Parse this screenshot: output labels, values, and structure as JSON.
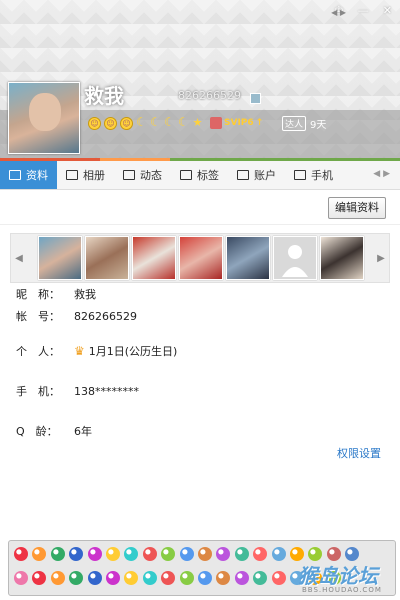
{
  "window": {
    "minimize_icon": "minimize-icon",
    "close_icon": "close-icon",
    "pin_label": "♔",
    "min_label": "—",
    "close_label": "✕"
  },
  "profile": {
    "nickname": "救我",
    "qq_number": "826266529",
    "svip_label": "SVIP6",
    "daren_tag": "达人",
    "daren_days": "9天"
  },
  "tabs": [
    {
      "label": "资料",
      "icon": "profile-card-icon",
      "active": true
    },
    {
      "label": "相册",
      "icon": "photo-icon"
    },
    {
      "label": "动态",
      "icon": "feed-icon"
    },
    {
      "label": "标签",
      "icon": "tag-icon"
    },
    {
      "label": "账户",
      "icon": "wallet-icon"
    },
    {
      "label": "手机",
      "icon": "phone-icon"
    }
  ],
  "edit_button": "编辑资料",
  "fields": {
    "nickname": {
      "label": "昵　称：",
      "value": "救我"
    },
    "account": {
      "label": "帐　号：",
      "value": "826266529"
    },
    "personal": {
      "label": "个　人：",
      "value": "1月1日(公历生日)"
    },
    "phone": {
      "label": "手　机：",
      "value": "138********"
    },
    "qage": {
      "label": "Q　龄：",
      "value": "6年"
    }
  },
  "permission_link": "权限设置",
  "watermark": {
    "big": "猴岛论坛",
    "small": "BBS.HOUDAO.COM"
  },
  "colors": {
    "accent": "#3a8fd6",
    "link": "#2a78c8",
    "svip": "#ffcc33"
  }
}
